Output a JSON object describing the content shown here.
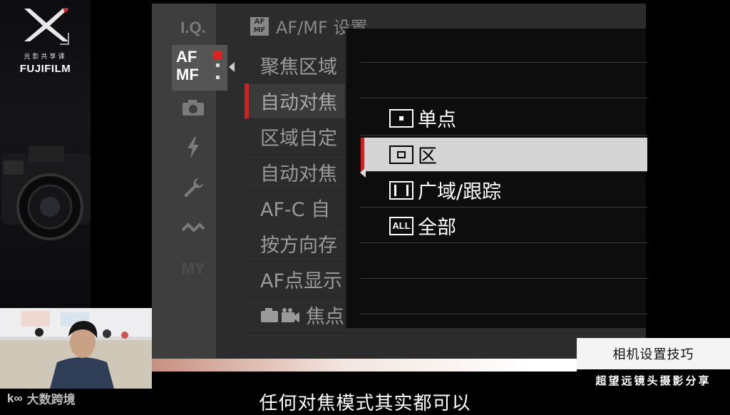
{
  "promo": {
    "subtitle": "光影共享课",
    "brand": "FUJIFILM",
    "camera_label": "FUJIFILM"
  },
  "camera_menu": {
    "tabs": [
      {
        "label": "I.Q.",
        "icon": "iq-tab"
      },
      {
        "label": "AF MF",
        "icon": "af-mf-tab"
      },
      {
        "label": "",
        "icon": "camera-icon"
      },
      {
        "label": "",
        "icon": "flash-icon"
      },
      {
        "label": "",
        "icon": "wrench-icon"
      },
      {
        "label": "",
        "icon": "wireless-icon"
      },
      {
        "label": "MY",
        "icon": "my-menu-tab"
      }
    ],
    "header_icon": "AF MF",
    "header_title": "AF/MF 设置",
    "items": [
      "聚焦区域",
      "自动对焦",
      "区域自定",
      "自动对焦",
      "AF-C 自",
      "按方向存",
      "AF点显示",
      "焦点"
    ],
    "selected_index": 1,
    "accent_color": "#cc2222"
  },
  "popup": {
    "options": [
      {
        "icon": "·",
        "label": "单点"
      },
      {
        "icon": "[ ]",
        "label": "区"
      },
      {
        "icon": "[  ]",
        "label": "广域/跟踪"
      },
      {
        "icon": "ALL",
        "label": "全部"
      }
    ],
    "selected_index": 1
  },
  "overlay": {
    "tip_title": "相机设置技巧",
    "tip_subtitle": "超望远镜头摄影分享",
    "subtitle": "任何对焦模式其实都可以",
    "watermark": "大数跨境"
  }
}
